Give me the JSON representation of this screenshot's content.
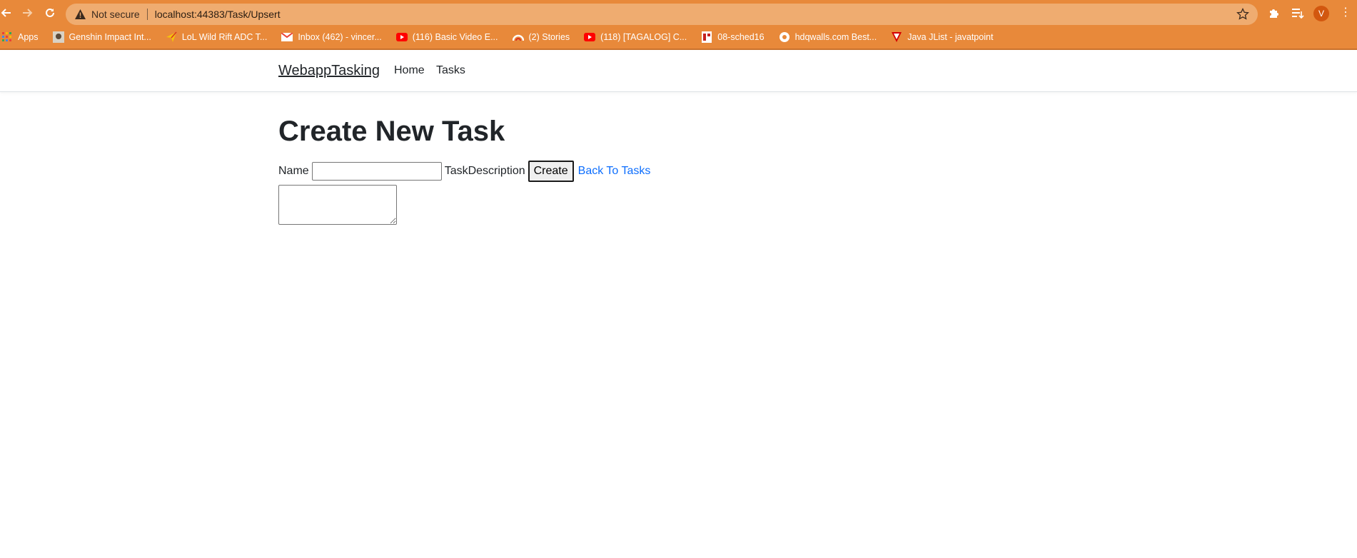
{
  "browser": {
    "security_label": "Not secure",
    "url": "localhost:44383/Task/Upsert",
    "profile_initial": "V",
    "bookmarks": [
      {
        "label": "Apps",
        "icon": "apps-grid-icon"
      },
      {
        "label": "Genshin Impact Int...",
        "icon": "genshin-icon"
      },
      {
        "label": "LoL Wild Rift ADC T...",
        "icon": "paper-plane-icon"
      },
      {
        "label": "Inbox (462) - vincer...",
        "icon": "gmail-icon"
      },
      {
        "label": "(116) Basic Video E...",
        "icon": "youtube-icon"
      },
      {
        "label": "(2) Stories",
        "icon": "stories-icon"
      },
      {
        "label": "(118) [TAGALOG] C...",
        "icon": "youtube-icon"
      },
      {
        "label": "08-sched16",
        "icon": "doc-icon"
      },
      {
        "label": "hdqwalls.com Best...",
        "icon": "globe-icon"
      },
      {
        "label": "Java JList - javatpoint",
        "icon": "javatpoint-icon"
      }
    ]
  },
  "site": {
    "brand": "WebappTasking",
    "nav": {
      "home": "Home",
      "tasks": "Tasks"
    }
  },
  "form": {
    "title": "Create New Task",
    "name_label": "Name",
    "name_value": "",
    "description_label": "TaskDescription",
    "description_value": "",
    "create_label": "Create",
    "back_label": "Back To Tasks"
  },
  "colors": {
    "chrome": "#e8893a",
    "omnibox": "#efac70",
    "link": "#0d6efd",
    "text": "#212529"
  }
}
